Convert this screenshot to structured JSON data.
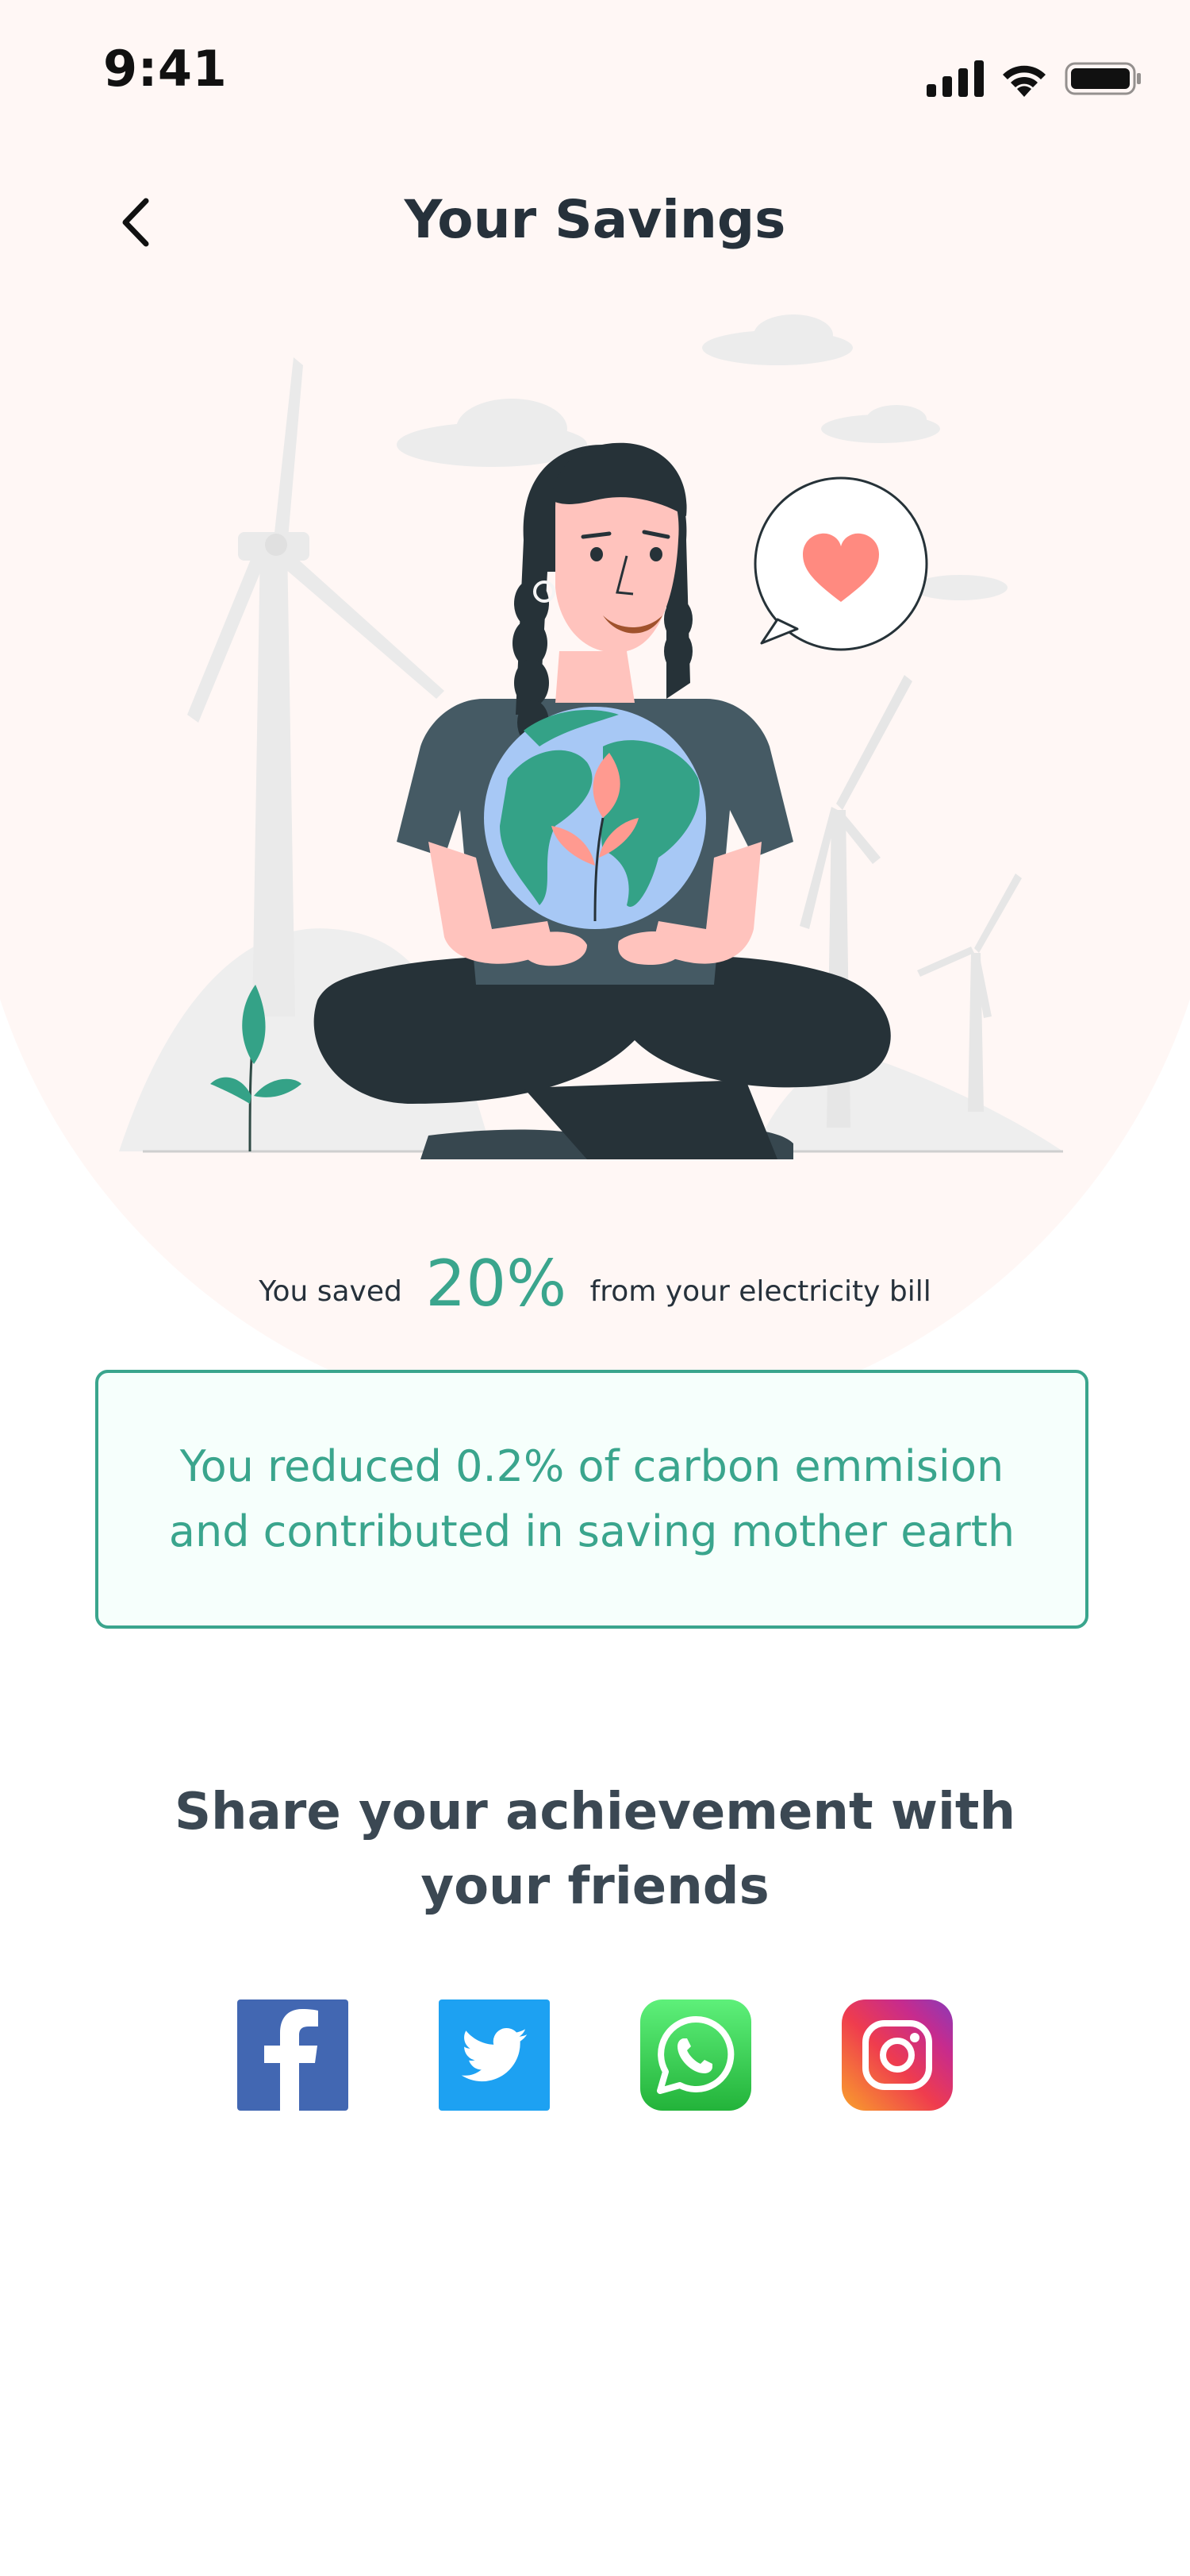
{
  "status_bar": {
    "time": "9:41"
  },
  "header": {
    "title": "Your Savings"
  },
  "savings": {
    "prefix": "You saved",
    "percent": "20%",
    "suffix": "from your electricity bill"
  },
  "carbon": {
    "line1": "You reduced 0.2% of carbon emmision",
    "line2": "and contributed in saving mother earth"
  },
  "share": {
    "title_line1": "Share your achievement with",
    "title_line2": "your friends",
    "networks": [
      {
        "name": "Facebook",
        "icon": "facebook-icon",
        "color": "#4267b2"
      },
      {
        "name": "Twitter",
        "icon": "twitter-icon",
        "color": "#1da1f2"
      },
      {
        "name": "WhatsApp",
        "icon": "whatsapp-icon",
        "color": "#2dbb43"
      },
      {
        "name": "Instagram",
        "icon": "instagram-icon",
        "color": "#e1306c"
      }
    ]
  },
  "colors": {
    "accent": "#3aa58d",
    "hero_bg": "#fff7f5",
    "text": "#26313b"
  }
}
